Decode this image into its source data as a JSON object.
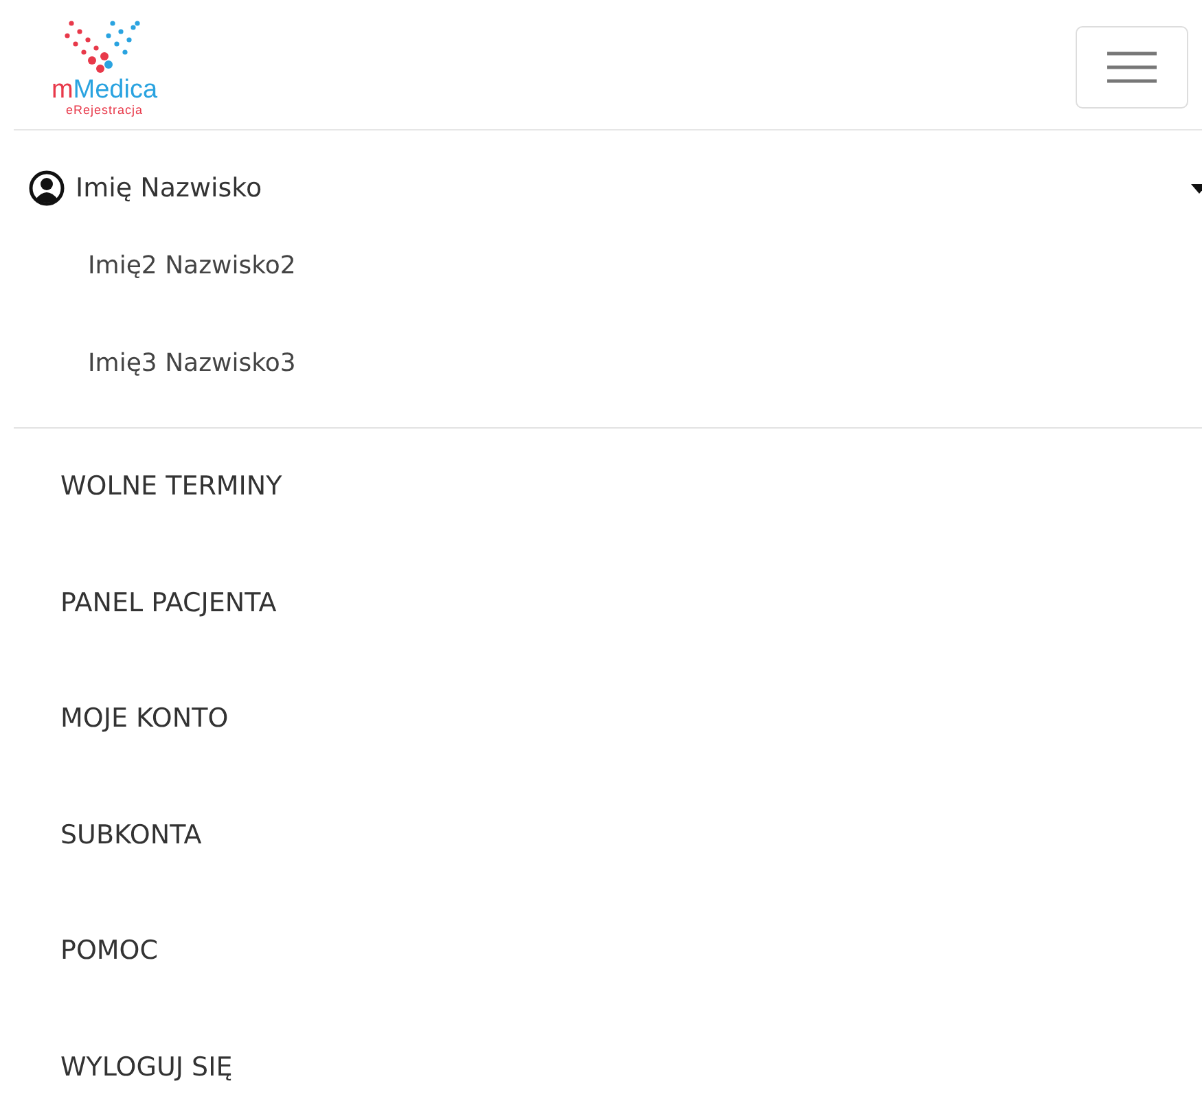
{
  "logo": {
    "prefix": "m",
    "name": "Medica",
    "sub": "eRejestracja"
  },
  "user": {
    "name": "Imię Nazwisko",
    "expanded": true,
    "children": [
      {
        "name": "Imię2 Nazwisko2"
      },
      {
        "name": "Imię3 Nazwisko3"
      }
    ]
  },
  "menu": [
    {
      "label": "WOLNE TERMINY"
    },
    {
      "label": "PANEL PACJENTA"
    },
    {
      "label": "MOJE KONTO"
    },
    {
      "label": "SUBKONTA"
    },
    {
      "label": "POMOC"
    },
    {
      "label": "WYLOGUJ SIĘ"
    }
  ]
}
